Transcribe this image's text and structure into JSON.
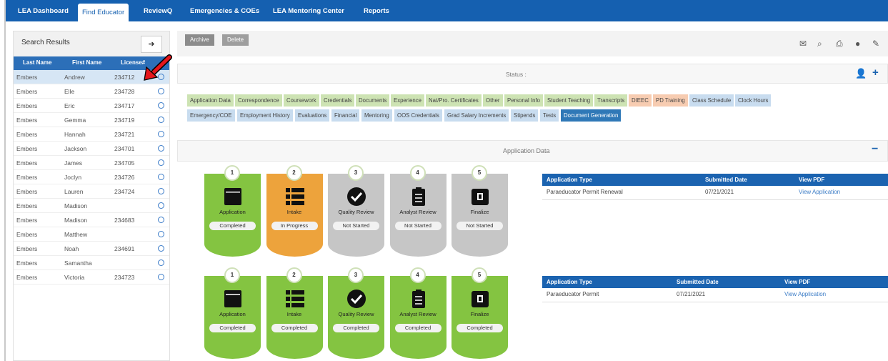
{
  "nav": {
    "tabs": [
      "LEA Dashboard",
      "Find Educator",
      "ReviewQ",
      "Emergencies & COEs",
      "LEA Mentoring Center",
      "Reports"
    ],
    "active": "Find Educator"
  },
  "search": {
    "title": "Search Results",
    "go_icon": "arrow-right-icon",
    "columns": [
      "Last Name",
      "First Name",
      "License#"
    ],
    "rows": [
      {
        "last": "Embers",
        "first": "Andrew",
        "license": "234712"
      },
      {
        "last": "Embers",
        "first": "Elle",
        "license": "234728"
      },
      {
        "last": "Embers",
        "first": "Eric",
        "license": "234717"
      },
      {
        "last": "Embers",
        "first": "Gemma",
        "license": "234719"
      },
      {
        "last": "Embers",
        "first": "Hannah",
        "license": "234721"
      },
      {
        "last": "Embers",
        "first": "Jackson",
        "license": "234701"
      },
      {
        "last": "Embers",
        "first": "James",
        "license": "234705"
      },
      {
        "last": "Embers",
        "first": "Joclyn",
        "license": "234726"
      },
      {
        "last": "Embers",
        "first": "Lauren",
        "license": "234724"
      },
      {
        "last": "Embers",
        "first": "Madison",
        "license": ""
      },
      {
        "last": "Embers",
        "first": "Madison",
        "license": "234683"
      },
      {
        "last": "Embers",
        "first": "Matthew",
        "license": ""
      },
      {
        "last": "Embers",
        "first": "Noah",
        "license": "234691"
      },
      {
        "last": "Embers",
        "first": "Samantha",
        "license": ""
      },
      {
        "last": "Embers",
        "first": "Victoria",
        "license": "234723"
      }
    ]
  },
  "toolbar": {
    "archive": "Archive",
    "delete": "Delete",
    "icons": [
      "envelope-icon",
      "search-icon",
      "print-icon",
      "comment-icon",
      "edit-icon"
    ]
  },
  "status": {
    "label": "Status :"
  },
  "tabs": {
    "row1": [
      {
        "label": "Application Data",
        "color": "g"
      },
      {
        "label": "Correspondence",
        "color": "g"
      },
      {
        "label": "Coursework",
        "color": "g"
      },
      {
        "label": "Credentials",
        "color": "g"
      },
      {
        "label": "Documents",
        "color": "g"
      },
      {
        "label": "Experience",
        "color": "g"
      },
      {
        "label": "Nat/Pro. Certificates",
        "color": "g"
      },
      {
        "label": "Other",
        "color": "g"
      },
      {
        "label": "Personal Info",
        "color": "g"
      },
      {
        "label": "Student Teaching",
        "color": "g"
      },
      {
        "label": "Transcripts",
        "color": "g"
      },
      {
        "label": "DIEEC",
        "color": "o"
      },
      {
        "label": "PD Training",
        "color": "o"
      },
      {
        "label": "Class Schedule",
        "color": "b"
      },
      {
        "label": "Clock Hours",
        "color": "b"
      }
    ],
    "row2": [
      {
        "label": "Emergency/COE",
        "color": "b"
      },
      {
        "label": "Employment History",
        "color": "b"
      },
      {
        "label": "Evaluations",
        "color": "b"
      },
      {
        "label": "Financial",
        "color": "b"
      },
      {
        "label": "Mentoring",
        "color": "b"
      },
      {
        "label": "OOS Credentials",
        "color": "b"
      },
      {
        "label": "Grad Salary Increments",
        "color": "b"
      },
      {
        "label": "Stipends",
        "color": "b"
      },
      {
        "label": "Tests",
        "color": "b"
      },
      {
        "label": "Document Generation",
        "color": "act"
      }
    ]
  },
  "section": {
    "title": "Application Data",
    "collapse": "−"
  },
  "workflow1": [
    {
      "num": "1",
      "label": "Application",
      "status": "Completed",
      "color": "green",
      "icon": "window-icon"
    },
    {
      "num": "2",
      "label": "Intake",
      "status": "In Progress",
      "color": "orange",
      "icon": "list-icon"
    },
    {
      "num": "3",
      "label": "Quality Review",
      "status": "Not Started",
      "color": "grey",
      "icon": "check-circle-icon"
    },
    {
      "num": "4",
      "label": "Analyst Review",
      "status": "Not Started",
      "color": "grey",
      "icon": "clipboard-icon"
    },
    {
      "num": "5",
      "label": "Finalize",
      "status": "Not Started",
      "color": "grey",
      "icon": "finalize-icon"
    }
  ],
  "workflow2": [
    {
      "num": "1",
      "label": "Application",
      "status": "Completed",
      "color": "green",
      "icon": "window-icon"
    },
    {
      "num": "2",
      "label": "Intake",
      "status": "Completed",
      "color": "green",
      "icon": "list-icon"
    },
    {
      "num": "3",
      "label": "Quality Review",
      "status": "Completed",
      "color": "green",
      "icon": "check-circle-icon"
    },
    {
      "num": "4",
      "label": "Analyst Review",
      "status": "Completed",
      "color": "green",
      "icon": "clipboard-icon"
    },
    {
      "num": "5",
      "label": "Finalize",
      "status": "Completed",
      "color": "green",
      "icon": "finalize-icon"
    }
  ],
  "app1": {
    "headers": [
      "Application Type",
      "Submitted Date",
      "View PDF"
    ],
    "type": "Paraeducator Permit Renewal",
    "date": "07/21/2021",
    "link": "View Application"
  },
  "app2": {
    "headers": [
      "Application Type",
      "Submitted Date",
      "View PDF"
    ],
    "type": "Paraeducator Permit",
    "date": "07/21/2021",
    "link": "View Application"
  }
}
